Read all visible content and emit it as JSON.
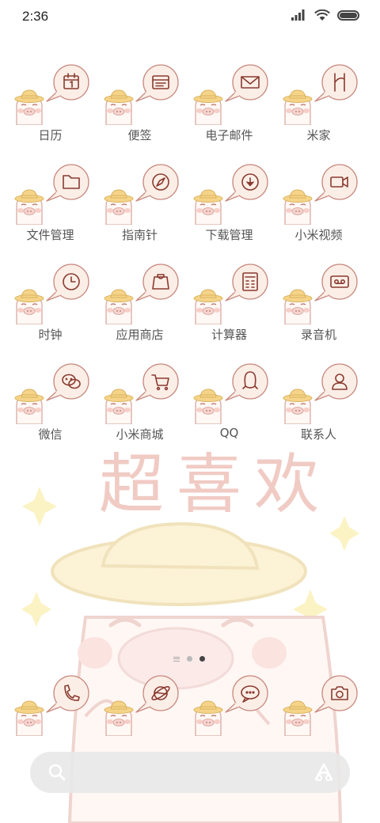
{
  "status_bar": {
    "time": "2:36",
    "icons": [
      "signal-icon",
      "wifi-icon",
      "battery-icon"
    ]
  },
  "wallpaper": {
    "text": "超喜欢"
  },
  "apps": [
    {
      "label": "日历",
      "icon": "calendar-icon"
    },
    {
      "label": "便签",
      "icon": "notes-icon"
    },
    {
      "label": "电子邮件",
      "icon": "mail-icon"
    },
    {
      "label": "米家",
      "icon": "mijia-icon"
    },
    {
      "label": "文件管理",
      "icon": "folder-icon"
    },
    {
      "label": "指南针",
      "icon": "compass-icon"
    },
    {
      "label": "下载管理",
      "icon": "download-icon"
    },
    {
      "label": "小米视频",
      "icon": "video-icon"
    },
    {
      "label": "时钟",
      "icon": "clock-icon"
    },
    {
      "label": "应用商店",
      "icon": "store-icon"
    },
    {
      "label": "计算器",
      "icon": "calculator-icon"
    },
    {
      "label": "录音机",
      "icon": "recorder-icon"
    },
    {
      "label": "微信",
      "icon": "wechat-icon"
    },
    {
      "label": "小米商城",
      "icon": "cart-icon"
    },
    {
      "label": "QQ",
      "icon": "qq-icon"
    },
    {
      "label": "联系人",
      "icon": "contacts-icon"
    }
  ],
  "dock": [
    {
      "icon": "phone-icon"
    },
    {
      "icon": "browser-icon"
    },
    {
      "icon": "messages-icon"
    },
    {
      "icon": "camera-icon"
    }
  ],
  "page_indicator": {
    "pages": 2,
    "current": 2
  },
  "colors": {
    "icon_stroke": "#8a3a30",
    "bubble_fill": "#fbeee6",
    "hat": "#f5d48a",
    "wallpaper_text": "#efc6bf",
    "label": "#555555"
  }
}
